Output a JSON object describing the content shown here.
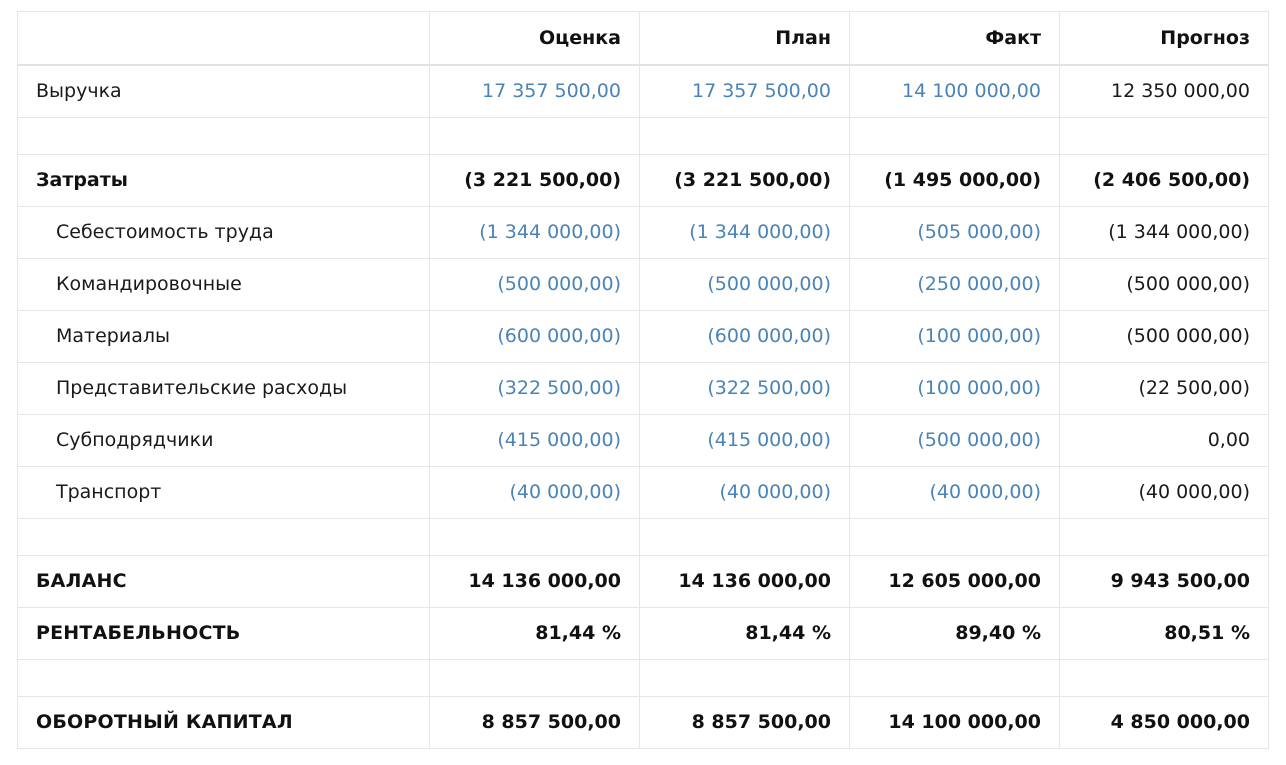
{
  "columns": [
    "",
    "Оценка",
    "План",
    "Факт",
    "Прогноз"
  ],
  "rows": [
    {
      "label": "Выручка",
      "values": [
        "17 357 500,00",
        "17 357 500,00",
        "14 100 000,00",
        "12 350 000,00"
      ]
    },
    {
      "label": "Затраты",
      "values": [
        "(3 221 500,00)",
        "(3 221 500,00)",
        "(1 495 000,00)",
        "(2 406 500,00)"
      ]
    },
    {
      "label": "Себестоимость труда",
      "values": [
        "(1 344 000,00)",
        "(1 344 000,00)",
        "(505 000,00)",
        "(1 344 000,00)"
      ]
    },
    {
      "label": "Командировочные",
      "values": [
        "(500 000,00)",
        "(500 000,00)",
        "(250 000,00)",
        "(500 000,00)"
      ]
    },
    {
      "label": "Материалы",
      "values": [
        "(600 000,00)",
        "(600 000,00)",
        "(100 000,00)",
        "(500 000,00)"
      ]
    },
    {
      "label": "Представительские расходы",
      "values": [
        "(322 500,00)",
        "(322 500,00)",
        "(100 000,00)",
        "(22 500,00)"
      ]
    },
    {
      "label": "Субподрядчики",
      "values": [
        "(415 000,00)",
        "(415 000,00)",
        "(500 000,00)",
        "0,00"
      ]
    },
    {
      "label": "Транспорт",
      "values": [
        "(40 000,00)",
        "(40 000,00)",
        "(40 000,00)",
        "(40 000,00)"
      ]
    },
    {
      "label": "БАЛАНС",
      "values": [
        "14 136 000,00",
        "14 136 000,00",
        "12 605 000,00",
        "9 943 500,00"
      ]
    },
    {
      "label": "РЕНТАБЕЛЬНОСТЬ",
      "values": [
        "81,44 %",
        "81,44 %",
        "89,40 %",
        "80,51 %"
      ]
    },
    {
      "label": "ОБОРОТНЫЙ КАПИТАЛ",
      "values": [
        "8 857 500,00",
        "8 857 500,00",
        "14 100 000,00",
        "4 850 000,00"
      ]
    }
  ],
  "colors": {
    "link": "#4a83b8",
    "text": "#1a1a1a",
    "border": "#e3e7ea"
  }
}
